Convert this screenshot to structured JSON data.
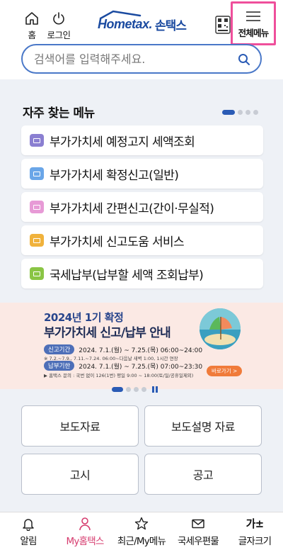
{
  "header": {
    "home_label": "홈",
    "login_label": "로그인",
    "logo_en": "Hometax.",
    "logo_ko": "손택스",
    "menu_label": "전체메뉴"
  },
  "search": {
    "placeholder": "검색어를 입력해주세요."
  },
  "favorites": {
    "title": "자주 찾는 메뉴",
    "items": [
      {
        "label": "부가가치세 예정고지 세액조회",
        "icon_color": "#8a7fd1"
      },
      {
        "label": "부가가치세 확정신고(일반)",
        "icon_color": "#6aa6e8"
      },
      {
        "label": "부가가치세 간편신고(간이·무실적)",
        "icon_color": "#e79ad6"
      },
      {
        "label": "부가가치세 신고도움 서비스",
        "icon_color": "#f0b23c"
      },
      {
        "label": "국세납부(납부할 세액 조회납부)",
        "icon_color": "#8ac545"
      }
    ]
  },
  "banner": {
    "title1": "2024년 1기 확정",
    "title2": "부가가치세 신고/납부 안내",
    "period_label": "신고기간",
    "period_value": "2024. 7.1.(월) ~ 7.25.(목) 06:00~24:00",
    "period_note": "※ 7.2.~7.9., 7.11.~7.24. 06:00~다음날 새벽 1:00, 1시간 연장",
    "due_label": "납부기한",
    "due_value": "2024. 7.1.(월) ~ 7.25.(목) 07:00~23:30",
    "contact": "▶ 홈택스 문의 : 국번 없이 126(1번) 평일 9:00 ~ 18:00(토/일/공휴일제외)",
    "go_label": "바로가기 >"
  },
  "grid": {
    "press": "보도자료",
    "press_explain": "보도설명 자료",
    "notice": "고시",
    "announcement": "공고"
  },
  "bottom_nav": {
    "alerts": "알림",
    "my_hometax": "My홈택스",
    "recent": "최근/My메뉴",
    "mail": "국세우편물",
    "font_size": "글자크기",
    "font_size_icon": "가±"
  },
  "colors": {
    "accent": "#2a5bb5",
    "highlight": "#ef4f9b",
    "active_nav": "#d63b6e",
    "banner_bg": "#fbe9e4"
  }
}
